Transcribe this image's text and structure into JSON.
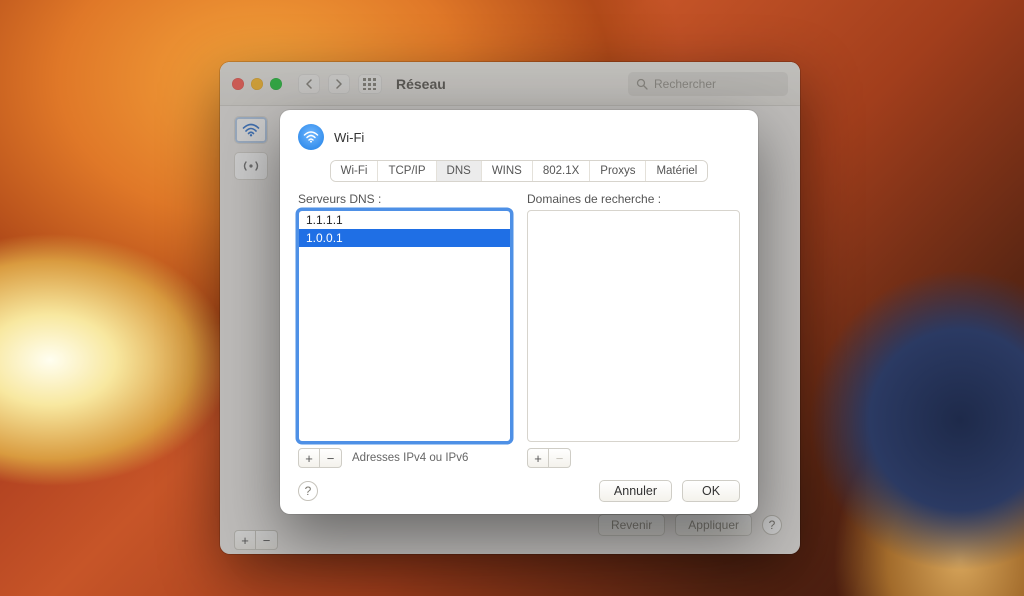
{
  "window": {
    "title": "Réseau",
    "search_placeholder": "Rechercher",
    "revert": "Revenir",
    "apply": "Appliquer"
  },
  "sheet": {
    "title": "Wi-Fi",
    "tabs": [
      "Wi-Fi",
      "TCP/IP",
      "DNS",
      "WINS",
      "802.1X",
      "Proxys",
      "Matériel"
    ],
    "active_tab": "DNS",
    "dns_label": "Serveurs DNS :",
    "search_domains_label": "Domaines de recherche :",
    "dns_servers": [
      "1.1.1.1",
      "1.0.0.1"
    ],
    "dns_selected_index": 1,
    "search_domains": [],
    "ipv_hint": "Adresses IPv4 ou IPv6",
    "cancel": "Annuler",
    "ok": "OK"
  }
}
